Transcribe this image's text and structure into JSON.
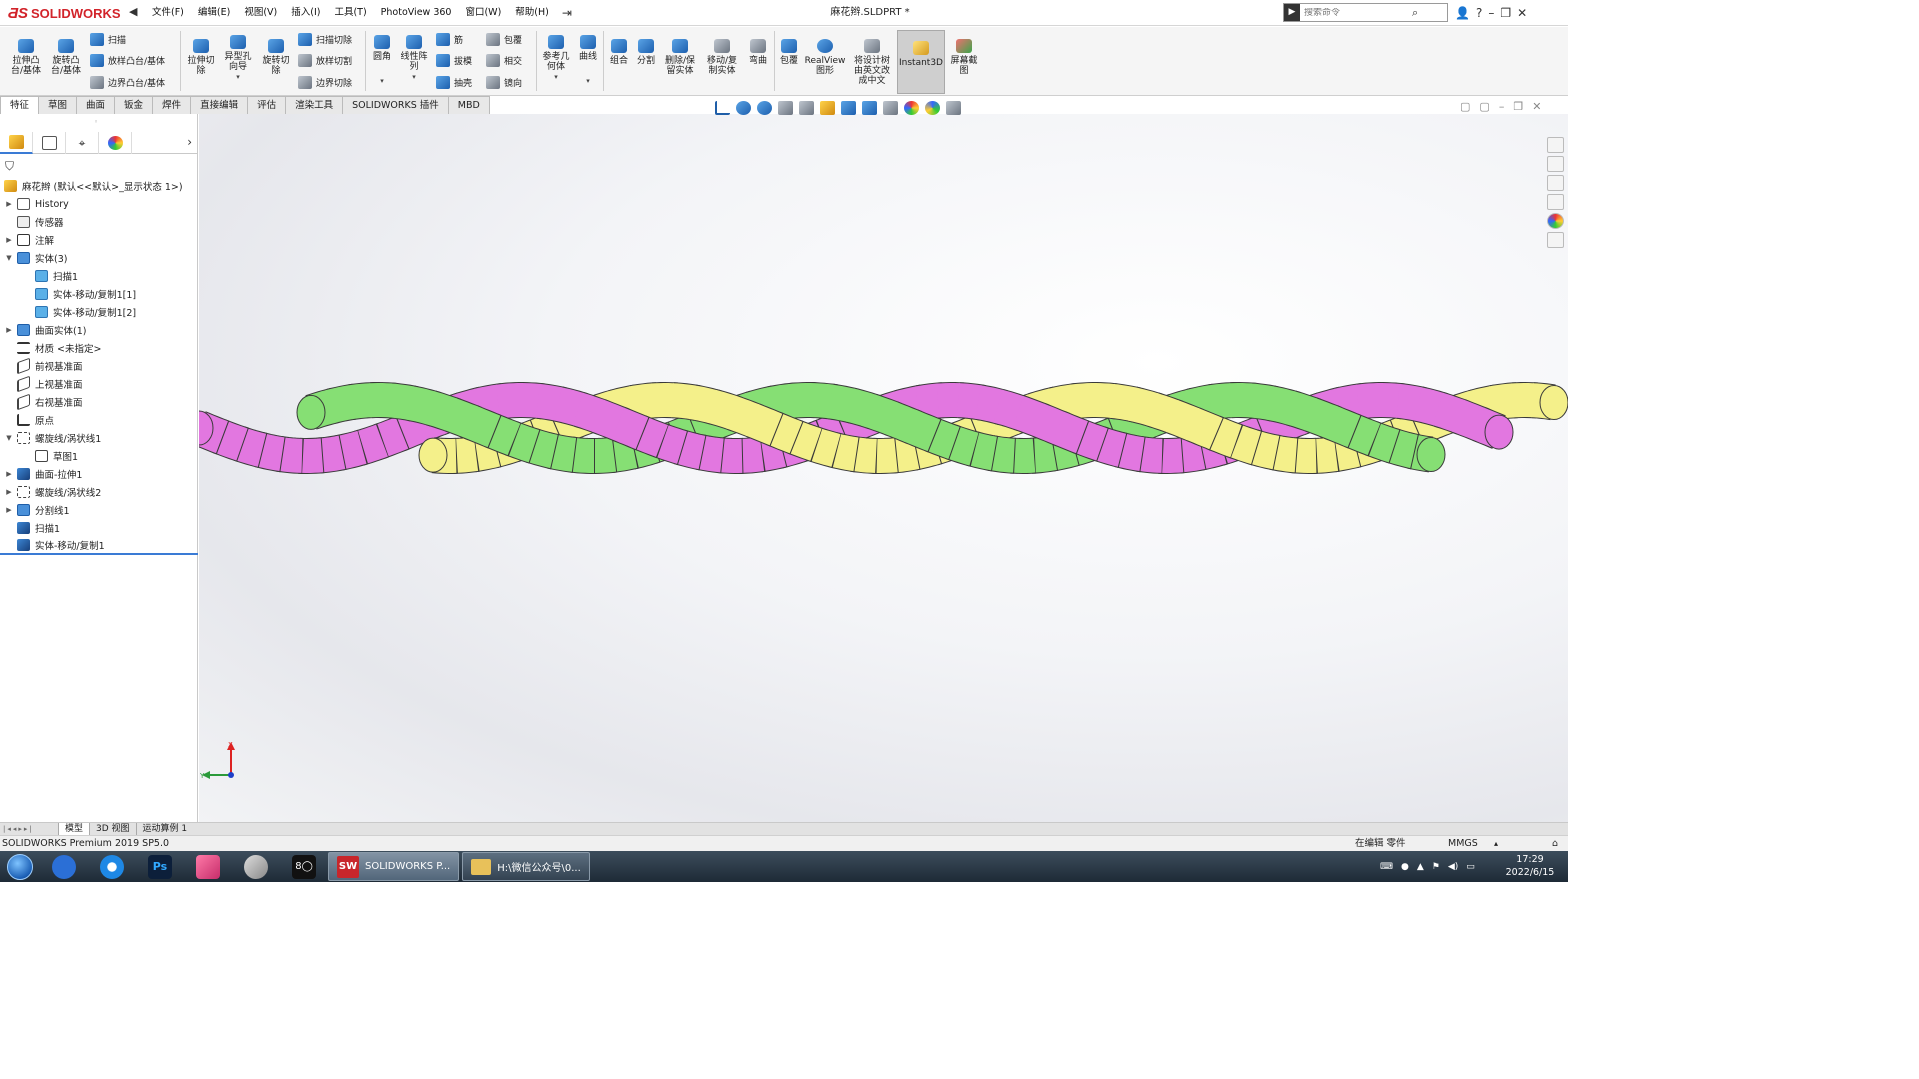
{
  "app": {
    "brand": "SOLIDWORKS",
    "document_title": "麻花辫.SLDPRT *"
  },
  "menu": [
    "文件(F)",
    "编辑(E)",
    "视图(V)",
    "插入(I)",
    "工具(T)",
    "PhotoView 360",
    "窗口(W)",
    "帮助(H)"
  ],
  "search": {
    "placeholder": "搜索命令"
  },
  "window_controls": [
    "👤",
    "?",
    "–",
    "❐",
    "✕"
  ],
  "commands": {
    "extrude_boss": "拉伸凸\n台/基体",
    "revolve_boss": "旋转凸\n台/基体",
    "sweep": "扫描",
    "loft": "放样凸台/基体",
    "boundary": "边界凸台/基体",
    "extrude_cut": "拉伸切\n除",
    "hole_wizard": "异型孔\n向导",
    "revolve_cut": "旋转切\n除",
    "sweep_cut": "扫描切除",
    "loft_cut": "放样切割",
    "boundary_cut": "边界切除",
    "fillet": "圆角",
    "linear_pattern": "线性阵\n列",
    "rib": "筋",
    "draft": "拔模",
    "shell": "抽壳",
    "wrap": "包覆",
    "intersect": "相交",
    "mirror": "镜向",
    "ref_geometry": "参考几\n何体",
    "curves": "曲线",
    "combine": "组合",
    "split": "分割",
    "delete_keep": "删除/保\n留实体",
    "move_copy": "移动/复\n制实体",
    "flex": "弯曲",
    "wrap2": "包覆",
    "realview": "RealView\n图形",
    "translate_tree": "将设计树\n由英文改\n成中文",
    "instant3d": "Instant3D",
    "screen_capture": "屏幕截\n图"
  },
  "tabs": [
    "特征",
    "草图",
    "曲面",
    "钣金",
    "焊件",
    "直接编辑",
    "评估",
    "渲染工具",
    "SOLIDWORKS 插件",
    "MBD"
  ],
  "tree": {
    "root": "麻花辫 (默认<<默认>_显示状态 1>)",
    "nodes": [
      {
        "label": "History",
        "icon": "history-icon",
        "exp": "▶",
        "indent": 0
      },
      {
        "label": "传感器",
        "icon": "sensor-icon",
        "exp": "",
        "indent": 0
      },
      {
        "label": "注解",
        "icon": "annotation-icon",
        "exp": "▶",
        "indent": 0
      },
      {
        "label": "实体(3)",
        "icon": "solid-bodies-icon",
        "exp": "▼",
        "indent": 0
      },
      {
        "label": "扫描1",
        "icon": "body-icon",
        "exp": "",
        "indent": 1
      },
      {
        "label": "实体-移动/复制1[1]",
        "icon": "body-icon",
        "exp": "",
        "indent": 1
      },
      {
        "label": "实体-移动/复制1[2]",
        "icon": "body-icon",
        "exp": "",
        "indent": 1
      },
      {
        "label": "曲面实体(1)",
        "icon": "surface-bodies-icon",
        "exp": "▶",
        "indent": 0
      },
      {
        "label": "材质 <未指定>",
        "icon": "material-icon",
        "exp": "",
        "indent": 0
      },
      {
        "label": "前视基准面",
        "icon": "plane-icon",
        "exp": "",
        "indent": 0
      },
      {
        "label": "上视基准面",
        "icon": "plane-icon",
        "exp": "",
        "indent": 0
      },
      {
        "label": "右视基准面",
        "icon": "plane-icon",
        "exp": "",
        "indent": 0
      },
      {
        "label": "原点",
        "icon": "origin-icon",
        "exp": "",
        "indent": 0
      },
      {
        "label": "螺旋线/涡状线1",
        "icon": "helix-icon",
        "exp": "▼",
        "indent": 0
      },
      {
        "label": "草图1",
        "icon": "sketch-icon",
        "exp": "",
        "indent": 1
      },
      {
        "label": "曲面-拉伸1",
        "icon": "surface-extrude-icon",
        "exp": "▶",
        "indent": 0
      },
      {
        "label": "螺旋线/涡状线2",
        "icon": "helix-icon",
        "exp": "▶",
        "indent": 0
      },
      {
        "label": "分割线1",
        "icon": "split-line-icon",
        "exp": "▶",
        "indent": 0
      },
      {
        "label": "扫描1",
        "icon": "sweep-icon",
        "exp": "",
        "indent": 0
      },
      {
        "label": "实体-移动/复制1",
        "icon": "move-copy-icon",
        "exp": "",
        "indent": 0
      }
    ]
  },
  "model": {
    "strand_colors": {
      "pink": "#e277e0",
      "green": "#86df74",
      "yellow": "#f4f08a"
    }
  },
  "triad": {
    "x_axis": "X",
    "y_axis": "Y"
  },
  "model_tabs": [
    "模型",
    "3D 视图",
    "运动算例 1"
  ],
  "status": {
    "app": "SOLIDWORKS Premium 2019 SP5.0",
    "editing": "在编辑 零件",
    "units": "MMGS"
  },
  "taskbar": {
    "sw_task": "SOLIDWORKS P...",
    "folder_task": "H:\\微信公众号\\0...",
    "time": "17:29",
    "date": "2022/6/15"
  }
}
